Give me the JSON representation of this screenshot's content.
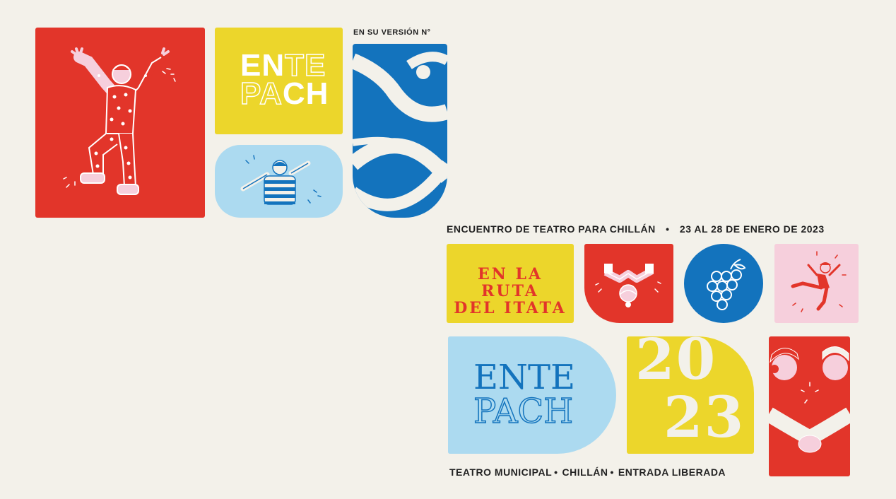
{
  "top": {
    "edition_label": "EN SU VERSIÓN N°",
    "logo_line1_a": "EN",
    "logo_line1_b": "TE",
    "logo_line2_a": "PA",
    "logo_line2_b": "CH"
  },
  "event": {
    "title": "ENCUENTRO DE TEATRO PARA CHILLÁN",
    "dates": "23 AL 28 DE ENERO DE 2023",
    "route_line1": "EN LA RUTA",
    "route_line2": "DEL ITATA",
    "logo_line1": "ENTE",
    "logo_line2": "PACH",
    "year_top": "20",
    "year_bottom": "23",
    "venue": "TEATRO MUNICIPAL",
    "city": "CHILLÁN",
    "entry": "ENTRADA LIBERADA"
  },
  "colors": {
    "background": "#f3f1ea",
    "red": "#e2352a",
    "yellow": "#ecd62b",
    "blue": "#1373bd",
    "light_blue": "#acdaf0",
    "pink": "#f6cfdc"
  }
}
